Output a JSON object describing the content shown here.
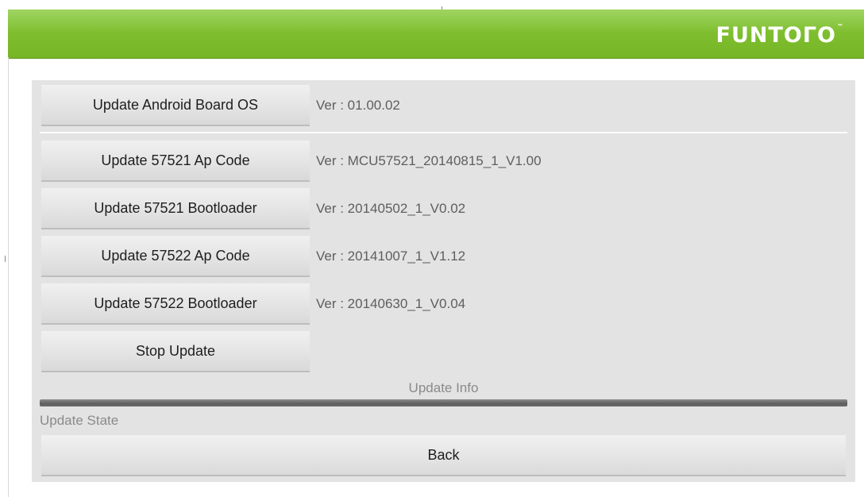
{
  "header": {
    "brand": "FUNTOΓO",
    "brand_tm": "™",
    "accent_color": "#7fbf2f"
  },
  "updates": [
    {
      "button_label": "Update Android Board OS",
      "version": "Ver : 01.00.02"
    },
    {
      "button_label": "Update 57521 Ap Code",
      "version": "Ver : MCU57521_20140815_1_V1.00"
    },
    {
      "button_label": "Update 57521 Bootloader",
      "version": "Ver : 20140502_1_V0.02"
    },
    {
      "button_label": "Update 57522 Ap Code",
      "version": "Ver : 20141007_1_V1.12"
    },
    {
      "button_label": "Update 57522 Bootloader",
      "version": "Ver : 20140630_1_V0.04"
    }
  ],
  "stop_button": {
    "label": "Stop Update"
  },
  "info": {
    "label": "Update Info",
    "progress": 1.0
  },
  "state": {
    "label": "Update State"
  },
  "back_button": {
    "label": "Back"
  }
}
